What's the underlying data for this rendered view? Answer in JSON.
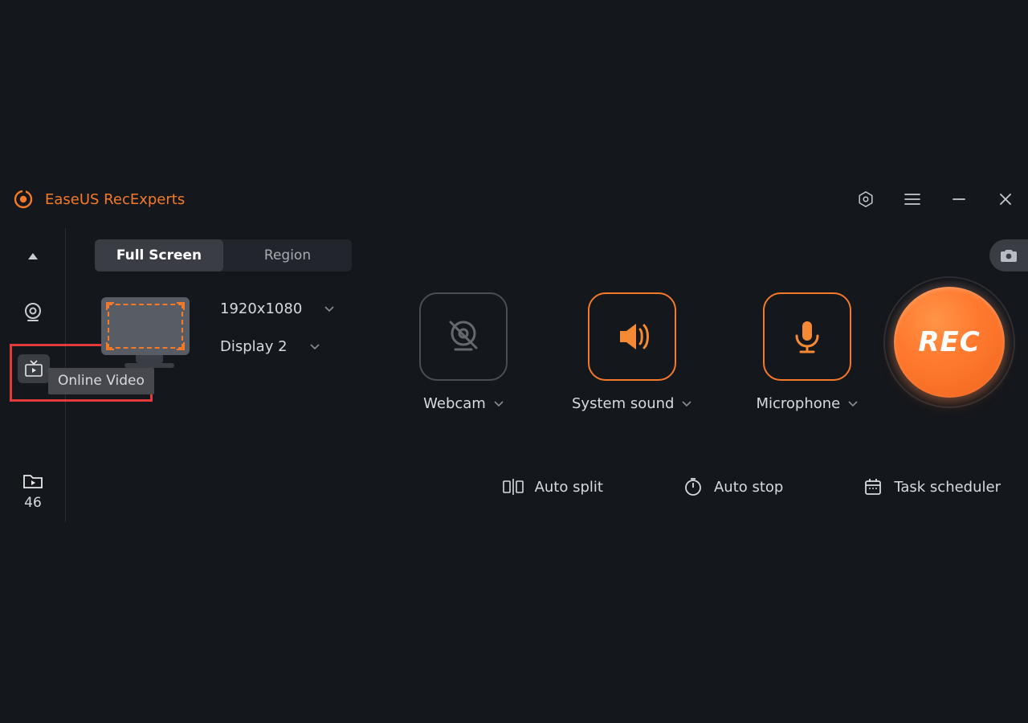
{
  "app_title": "EaseUS RecExperts",
  "tabs": {
    "full_screen": "Full Screen",
    "region": "Region"
  },
  "resolution": "1920x1080",
  "display": "Display 2",
  "sources": {
    "webcam": "Webcam",
    "system_sound": "System sound",
    "microphone": "Microphone"
  },
  "rec_label": "REC",
  "bottom": {
    "auto_split": "Auto split",
    "auto_stop": "Auto stop",
    "task_scheduler": "Task scheduler"
  },
  "sidebar": {
    "online_video_tooltip": "Online Video",
    "recordings_count": "46"
  }
}
